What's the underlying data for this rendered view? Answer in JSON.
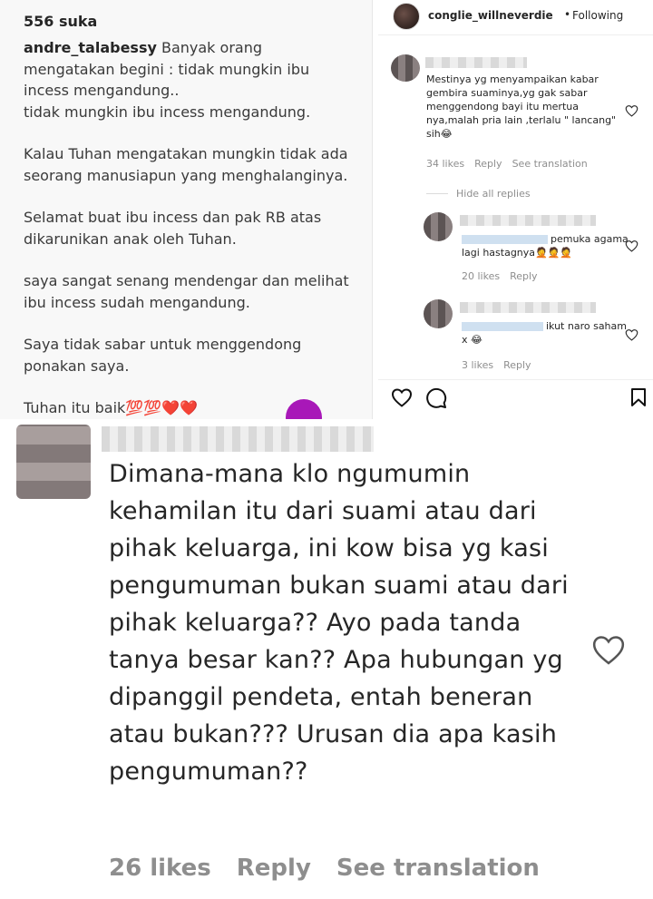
{
  "post": {
    "likes": "556 suka",
    "caption_user": "andre_talabessy",
    "caption_lines": [
      "Banyak orang mengatakan begini : tidak mungkin ibu incess mengandung..\ntidak mungkin ibu incess mengandung.",
      "Kalau Tuhan mengatakan mungkin tidak ada seorang manusiapun yang menghalanginya.",
      "Selamat buat ibu incess dan pak RB atas dikarunikan anak oleh Tuhan.",
      "saya sangat senang mendengar dan melihat ibu incess sudah mengandung.",
      "Saya tidak sabar untuk menggendong ponakan saya.",
      "Tuhan itu baik💯💯❤️❤️"
    ]
  },
  "thread": {
    "header": {
      "username": "conglie_willneverdie",
      "separator": "•",
      "follow_status": "Following"
    },
    "comment": {
      "text": "Mestinya yg menyampaikan kabar gembira suaminya,yg gak sabar menggendong bayi itu mertua nya,malah pria lain ,terlalu \" lancang\" sih😂",
      "likes": "34 likes",
      "reply": "Reply",
      "translate": "See translation"
    },
    "hide_replies": "Hide all replies",
    "replies": [
      {
        "text": "pemuka agama lagi hastagnya🤦🤦🤦",
        "likes": "20 likes",
        "reply": "Reply"
      },
      {
        "text": "ikut naro saham x 😂",
        "likes": "3 likes",
        "reply": "Reply"
      }
    ]
  },
  "big_comment": {
    "text": "Dimana-mana klo ngumumin kehamilan itu dari suami atau dari pihak keluarga, ini kow bisa yg kasi pengumuman bukan suami atau dari pihak keluarga?? Ayo pada tanda tanya besar kan?? Apa hubungan yg dipanggil pendeta, entah beneran atau bukan??? Urusan dia apa kasih pengumuman??",
    "likes": "26 likes",
    "reply": "Reply",
    "translate": "See translation"
  },
  "colors": {
    "text": "#262626",
    "meta": "#8e8e8e",
    "caption_bg": "#f8f8f8",
    "accent_purple": "#a818b8"
  },
  "icons": [
    "heart-icon",
    "comment-icon",
    "bookmark-icon",
    "avatar"
  ]
}
